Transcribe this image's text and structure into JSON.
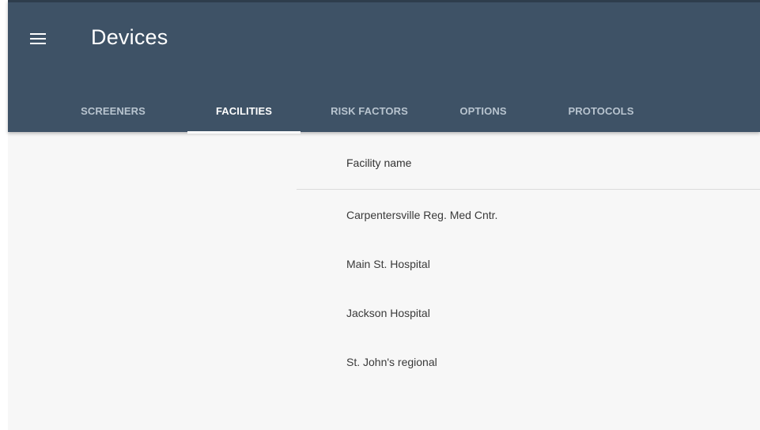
{
  "app": {
    "title": "Devices",
    "menu_icon": "hamburger-menu-icon"
  },
  "tabs": [
    {
      "label": "SCREENERS",
      "active": false
    },
    {
      "label": "FACILITIES",
      "active": true
    },
    {
      "label": "RISK FACTORS",
      "active": false
    },
    {
      "label": "OPTIONS",
      "active": false
    },
    {
      "label": "PROTOCOLS",
      "active": false
    }
  ],
  "facilities": {
    "column_header": "Facility name",
    "rows": [
      {
        "name": "Carpentersville Reg. Med Cntr."
      },
      {
        "name": "Main St. Hospital"
      },
      {
        "name": "Jackson Hospital"
      },
      {
        "name": "St. John's regional"
      }
    ]
  },
  "colors": {
    "header_bg": "#3e5266",
    "content_bg": "#f7f7f7",
    "active_tab": "#ffffff",
    "inactive_tab": "#b8c4cf"
  }
}
